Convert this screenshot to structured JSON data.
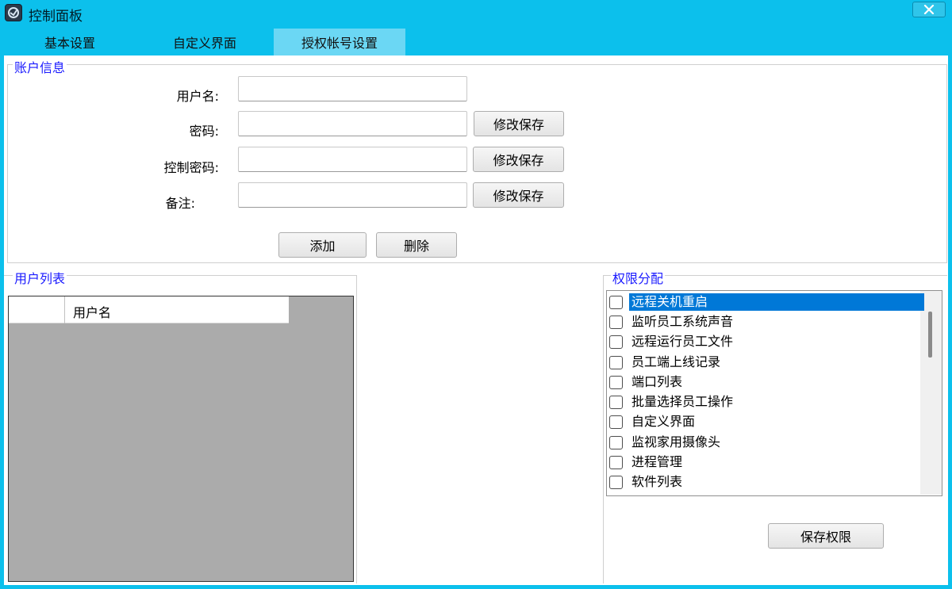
{
  "window": {
    "title": "控制面板",
    "close_icon": "close-icon"
  },
  "tabs": [
    {
      "label": "基本设置",
      "active": false
    },
    {
      "label": "自定义界面",
      "active": false
    },
    {
      "label": "授权帐号设置",
      "active": true
    }
  ],
  "account_info": {
    "legend": "账户信息",
    "fields": [
      {
        "label": "用户名:",
        "value": ""
      },
      {
        "label": "密码:",
        "value": "",
        "button": "修改保存"
      },
      {
        "label": "控制密码:",
        "value": "",
        "button": "修改保存"
      },
      {
        "label": "备注:",
        "value": "",
        "button": "修改保存"
      }
    ],
    "add_button": "添加",
    "delete_button": "删除"
  },
  "user_list": {
    "legend": "用户列表",
    "columns": [
      "",
      "用户名"
    ],
    "rows": []
  },
  "permissions": {
    "legend": "权限分配",
    "items": [
      {
        "label": "远程关机重启",
        "checked": false,
        "selected": true
      },
      {
        "label": "监听员工系统声音",
        "checked": false,
        "selected": false
      },
      {
        "label": "远程运行员工文件",
        "checked": false,
        "selected": false
      },
      {
        "label": "员工端上线记录",
        "checked": false,
        "selected": false
      },
      {
        "label": "端口列表",
        "checked": false,
        "selected": false
      },
      {
        "label": "批量选择员工操作",
        "checked": false,
        "selected": false
      },
      {
        "label": "自定义界面",
        "checked": false,
        "selected": false
      },
      {
        "label": "监视家用摄像头",
        "checked": false,
        "selected": false
      },
      {
        "label": "进程管理",
        "checked": false,
        "selected": false
      },
      {
        "label": "软件列表",
        "checked": false,
        "selected": false
      }
    ],
    "save_button": "保存权限"
  },
  "colors": {
    "titlebar": "#0cc0ec",
    "active_tab": "#6bd7f4",
    "legend_text": "#1a1aff",
    "selection": "#0078d7"
  }
}
